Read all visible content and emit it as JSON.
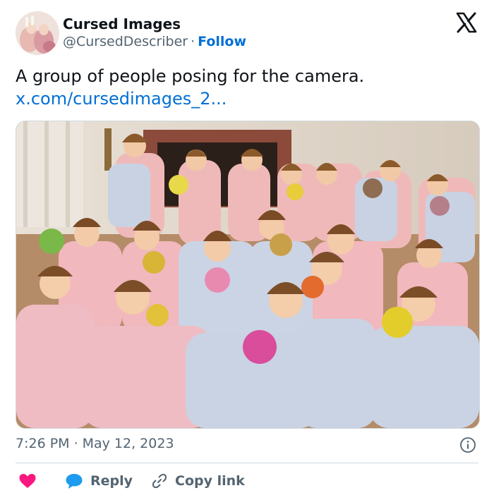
{
  "author": {
    "name": "Cursed Images",
    "handle": "@CursedDescriber",
    "separator": "·",
    "follow_label": "Follow"
  },
  "tweet": {
    "text": "A group of people posing for the camera.",
    "link": "x.com/cursedimages_2..."
  },
  "meta": {
    "time": "7:26 PM",
    "separator": "·",
    "date": "May 12, 2023"
  },
  "actions": {
    "reply_label": "Reply",
    "copy_label": "Copy link"
  },
  "icons": {
    "platform": "x-logo-icon",
    "info": "info-icon",
    "like": "heart-icon",
    "reply": "reply-bubble-icon",
    "copy": "link-icon"
  },
  "colors": {
    "link_blue": "#006fd6",
    "like_pink": "#f91880",
    "reply_blue": "#1d9bf0",
    "secondary_text": "#536471"
  }
}
